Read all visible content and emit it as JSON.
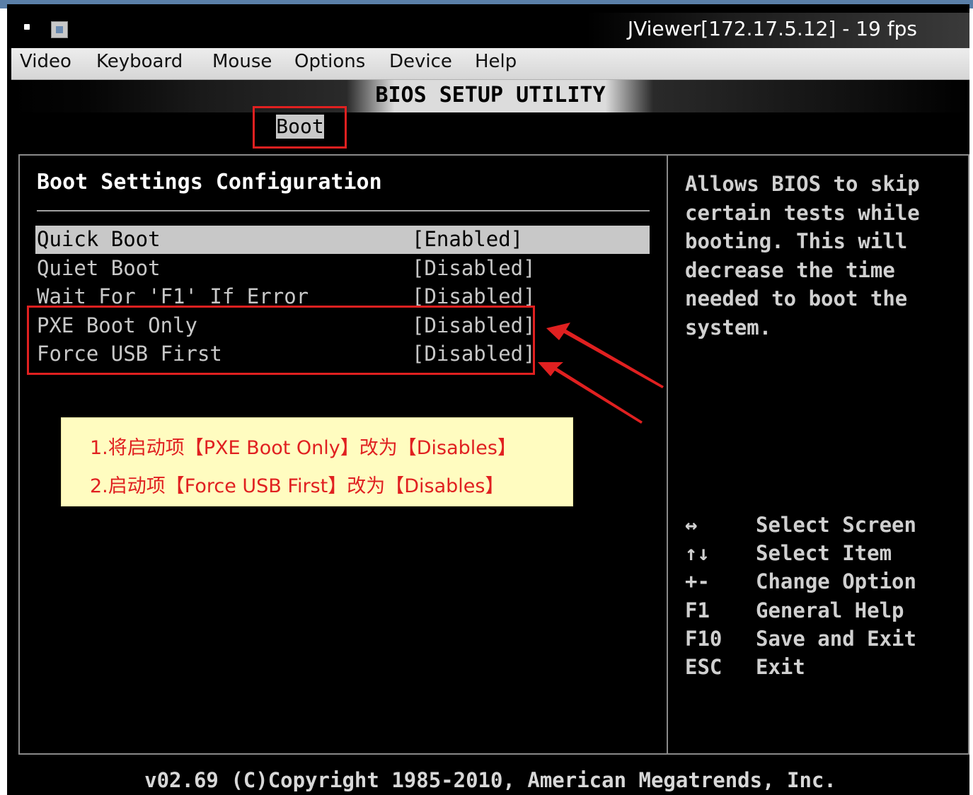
{
  "window": {
    "title": "JViewer[172.17.5.12] - 19 fps"
  },
  "menubar": {
    "items": [
      {
        "label": "Video"
      },
      {
        "label": "Keyboard"
      },
      {
        "label": "Mouse"
      },
      {
        "label": "Options"
      },
      {
        "label": "Device"
      },
      {
        "label": "Help"
      }
    ]
  },
  "bios": {
    "title": "BIOS SETUP UTILITY",
    "active_tab": "Boot",
    "section_title": "Boot Settings Configuration",
    "settings": [
      {
        "label": "Quick Boot",
        "value": "[Enabled]"
      },
      {
        "label": "Quiet Boot",
        "value": "[Disabled]"
      },
      {
        "label": "Wait For 'F1' If Error",
        "value": "[Disabled]"
      },
      {
        "label": "PXE Boot Only",
        "value": "[Disabled]"
      },
      {
        "label": "Force USB First",
        "value": "[Disabled]"
      }
    ],
    "help_text": "Allows BIOS to skip certain tests while booting. This will decrease the time needed to boot the system.",
    "key_legend": [
      {
        "key": "↔",
        "desc": "Select Screen"
      },
      {
        "key": "↑↓",
        "desc": "Select Item"
      },
      {
        "key": "+-",
        "desc": "Change Option"
      },
      {
        "key": "F1",
        "desc": "General Help"
      },
      {
        "key": "F10",
        "desc": "Save and Exit"
      },
      {
        "key": "ESC",
        "desc": "Exit"
      }
    ],
    "footer": "v02.69 (C)Copyright 1985-2010, American Megatrends, Inc."
  },
  "annotation": {
    "line1": "1.将启动项【PXE Boot Only】改为【Disables】",
    "line2": "2.启动项【Force USB First】改为【Disables】",
    "highlight_color": "#e02020"
  }
}
